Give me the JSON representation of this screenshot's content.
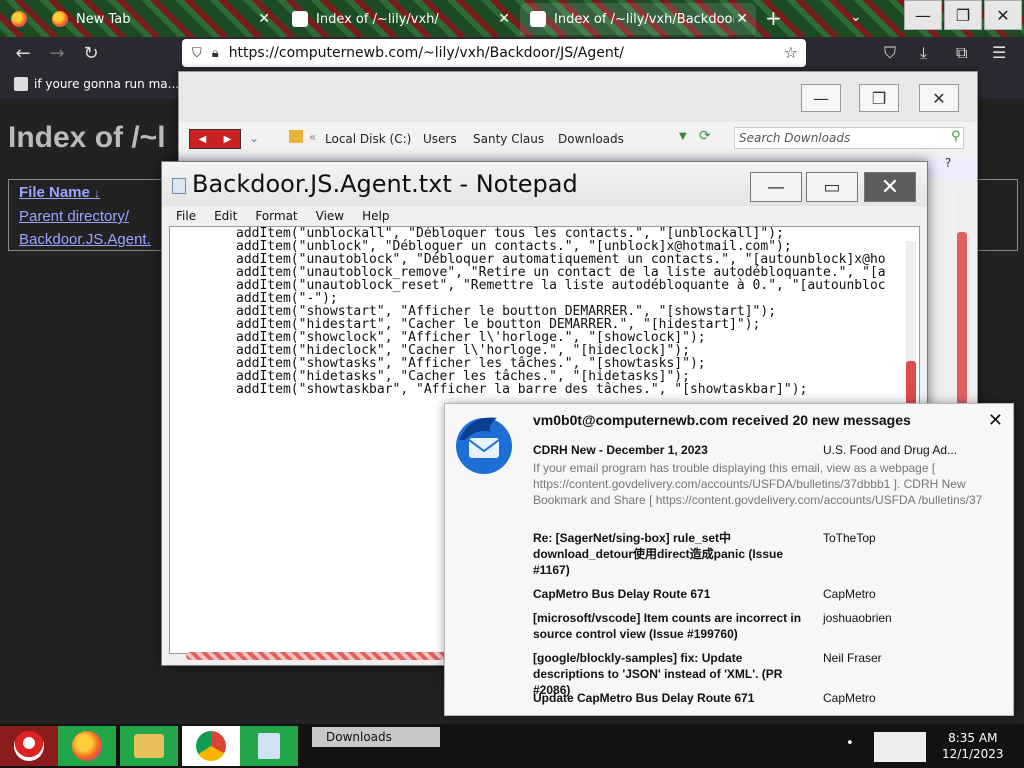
{
  "browser": {
    "tabs": [
      {
        "label": "New Tab",
        "active": false
      },
      {
        "label": "Index of /~lily/vxh/",
        "active": false
      },
      {
        "label": "Index of /~lily/vxh/Backdoor/JS/A",
        "active": true
      }
    ],
    "url": "https://computernewb.com/~lily/vxh/Backdoor/JS/Agent/",
    "bookmark": "if youre gonna run ma..."
  },
  "page": {
    "title": "Index of /~l",
    "column_header": "File Name",
    "sort_indicator": "↓",
    "links": [
      "Parent directory/",
      "Backdoor.JS.Agent."
    ]
  },
  "explorer": {
    "breadcrumbs": [
      "Local Disk (C:)",
      "Users",
      "Santy Claus",
      "Downloads"
    ],
    "search_placeholder": "Search Downloads"
  },
  "notepad": {
    "title": "Backdoor.JS.Agent.txt - Notepad",
    "menu": [
      "File",
      "Edit",
      "Format",
      "View",
      "Help"
    ],
    "lines": [
      "addItem(\"unblockall\", \"Débloquer tous les contacts.\", \"[unblockall]\");",
      "addItem(\"unblock\", \"Débloquer un contacts.\", \"[unblock]x@hotmail.com\");",
      "addItem(\"unautoblock\", \"Débloquer automatiquement un contacts.\", \"[autounblock]x@ho",
      "addItem(\"unautoblock_remove\", \"Retire un contact de la liste autodébloquante.\", \"[a",
      "addItem(\"unautoblock_reset\", \"Remettre la liste autodébloquante à 0.\", \"[autounbloc",
      "addItem(\"-\");",
      "addItem(\"showstart\", \"Afficher le boutton DEMARRER.\", \"[showstart]\");",
      "addItem(\"hidestart\", \"Cacher le boutton DEMARRER.\", \"[hidestart]\");",
      "addItem(\"showclock\", \"Afficher l\\'horloge.\", \"[showclock]\");",
      "addItem(\"hideclock\", \"Cacher l\\'horloge.\", \"[hideclock]\");",
      "addItem(\"showtasks\", \"Afficher les tâches.\", \"[showtasks]\");",
      "addItem(\"hidetasks\", \"Cacher les tâches.\", \"[hidetasks]\");",
      "addItem(\"showtaskbar\", \"Afficher la barre des tâches.\", \"[showtaskbar]\");"
    ]
  },
  "notification": {
    "header": "vm0b0t@computernewb.com received 20 new messages",
    "messages": [
      {
        "subject": "CDRH New - December 1, 2023",
        "from": "U.S. Food and Drug Ad...",
        "preview": "If your email program has trouble displaying this email, view as a webpage [ https://content.govdelivery.com/accounts/USFDA/bulletins/37dbbb1 ]. CDRH New Bookmark and Share [ https://content.govdelivery.com/accounts/USFDA /bulletins/37"
      },
      {
        "subject": "Re: [SagerNet/sing-box] rule_set中 download_detour使用direct造成panic (Issue #1167)",
        "from": "ToTheTop"
      },
      {
        "subject": "CapMetro Bus Delay Route 671",
        "from": "CapMetro"
      },
      {
        "subject": "[microsoft/vscode] Item counts are incorrect in source control view (Issue #199760)",
        "from": "joshuaobrien"
      },
      {
        "subject": "[google/blockly-samples] fix: Update descriptions to 'JSON' instead of 'XML'. (PR #2086)",
        "from": "Neil Fraser"
      },
      {
        "subject": "Update CapMetro Bus Delay Route 671",
        "from": "CapMetro"
      }
    ]
  },
  "taskbar": {
    "downloads_label": "Downloads",
    "time": "8:35 AM",
    "date": "12/1/2023"
  }
}
